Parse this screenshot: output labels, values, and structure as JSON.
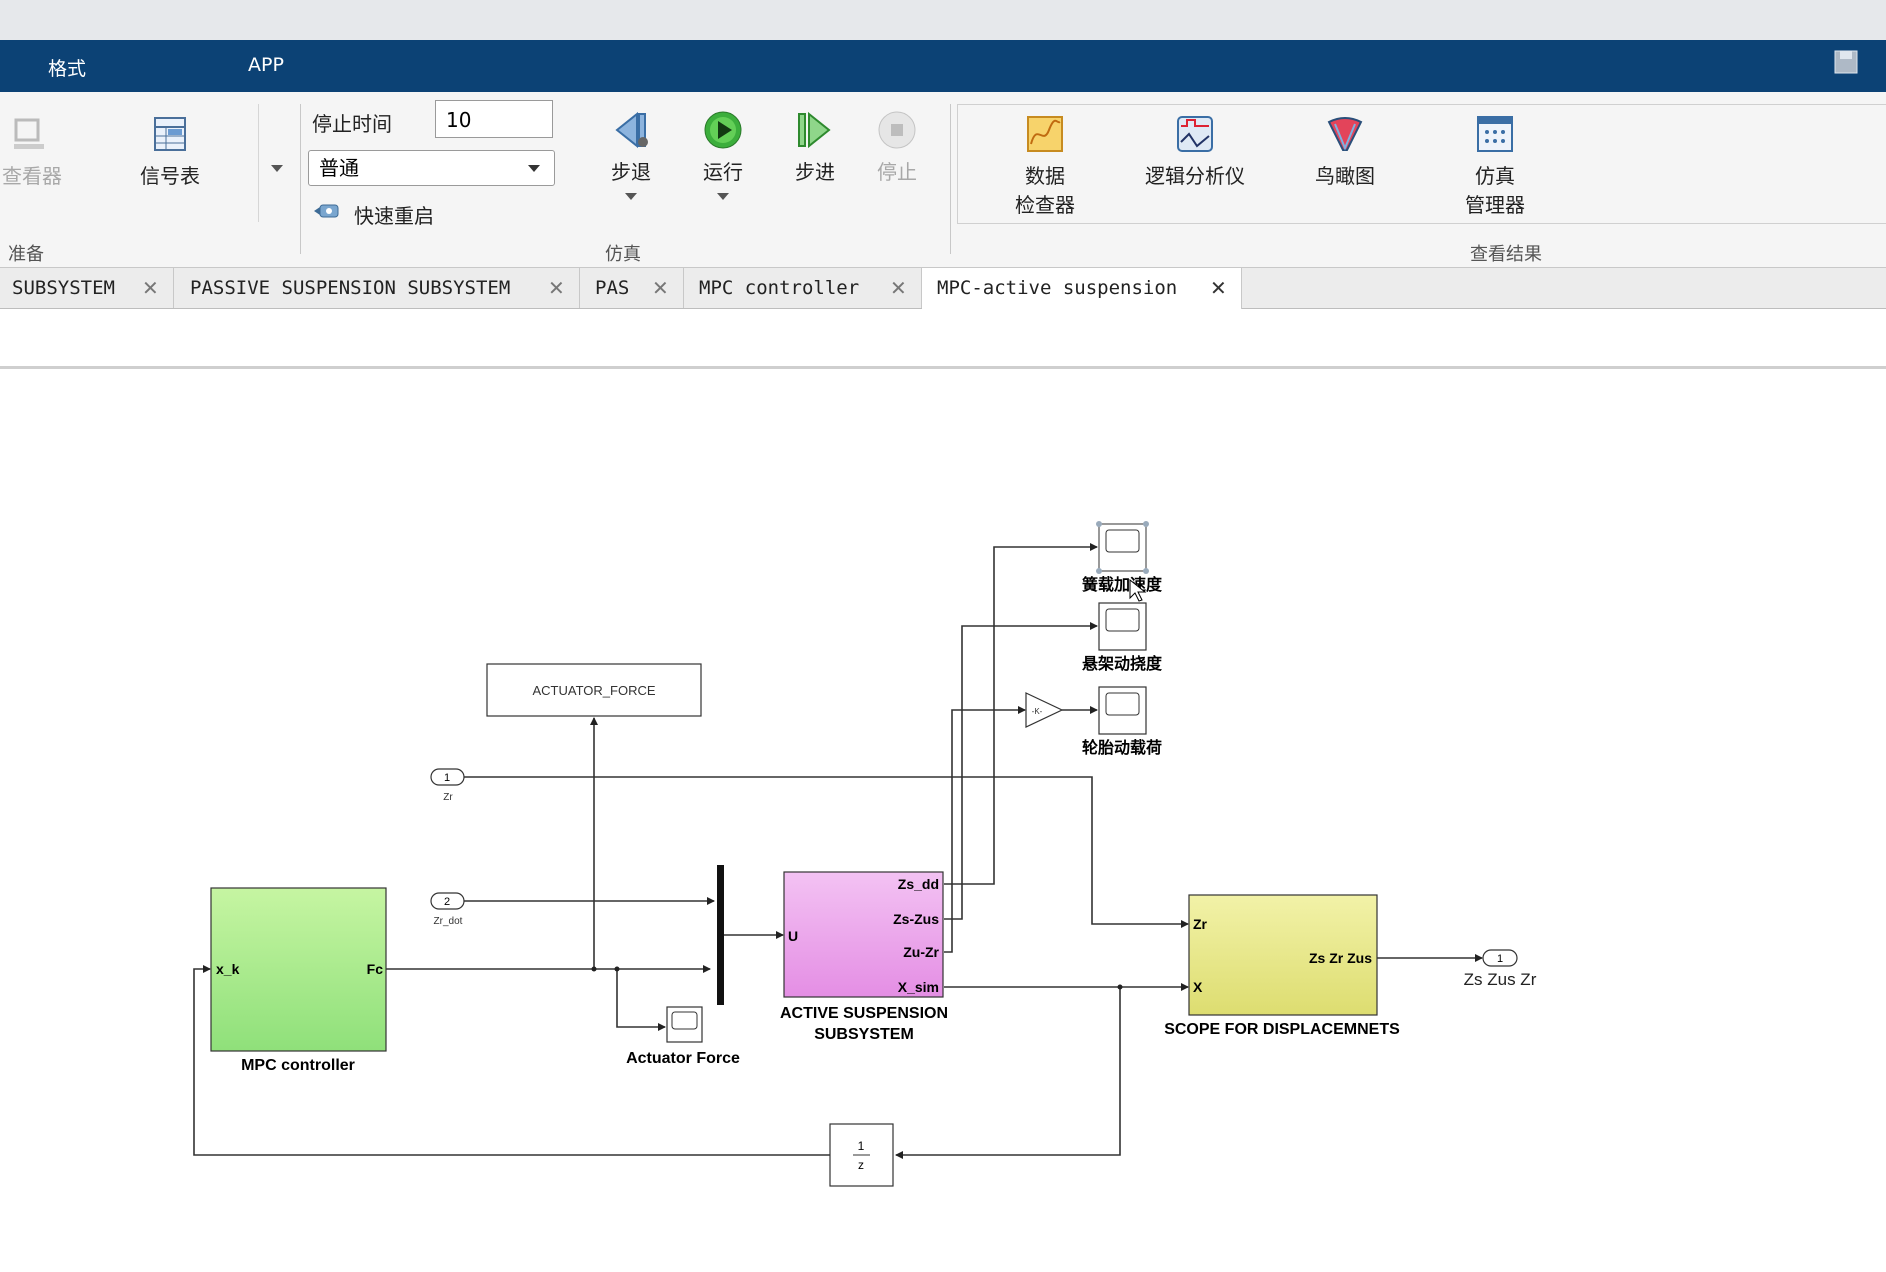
{
  "menu": {
    "format": "格式",
    "app": "APP"
  },
  "ribbon": {
    "prepare": {
      "viewer_label": "查看器",
      "signal_table_label": "信号表",
      "section_label": "准备"
    },
    "simulate": {
      "stop_time_label": "停止时间",
      "stop_time_value": "10",
      "mode_value": "普通",
      "fast_restart_label": "快速重启",
      "step_back_label": "步退",
      "run_label": "运行",
      "step_forward_label": "步进",
      "stop_label": "停止",
      "section_label": "仿真"
    },
    "review": {
      "data_inspector_line1": "数据",
      "data_inspector_line2": "检查器",
      "logic_analyzer_label": "逻辑分析仪",
      "birdseye_label": "鸟瞰图",
      "sim_manager_line1": "仿真",
      "sim_manager_line2": "管理器",
      "section_label": "查看结果"
    }
  },
  "tabs": [
    {
      "label": "SUBSYSTEM"
    },
    {
      "label": "PASSIVE SUSPENSION SUBSYSTEM"
    },
    {
      "label": "PAS"
    },
    {
      "label": "MPC controller"
    },
    {
      "label": "MPC-active suspension",
      "active": true
    }
  ],
  "tab_close_glyph": "✕",
  "diagram": {
    "actuator_force_goto": "ACTUATOR_FORCE",
    "inport1_number": "1",
    "inport1_name": "Zr",
    "inport2_number": "2",
    "inport2_name": "Zr_dot",
    "mpc_block": {
      "name": "MPC controller",
      "in_port": "x_k",
      "out_port": "Fc",
      "color": "#c6f5a2"
    },
    "active_block": {
      "name_line1": "ACTIVE SUSPENSION",
      "name_line2": "SUBSYSTEM",
      "in_port": "U",
      "out_ports": [
        "Zs_dd",
        "Zs-Zus",
        "Zu-Zr",
        "X_sim"
      ],
      "color": "#f3c2f3"
    },
    "scope_block": {
      "name": "SCOPE FOR DISPLACEMNETS",
      "in_ports": [
        "Zr",
        "X"
      ],
      "out_port": "Zs Zr Zus",
      "color": "#f2f2a8"
    },
    "scope1_label": "簧载加速度",
    "scope2_label": "悬架动挠度",
    "scope3_label": "轮胎动载荷",
    "actuator_scope_label": "Actuator Force",
    "outport_number": "1",
    "outport_name": "Zs Zus Zr",
    "gain_label": "-K-",
    "delay_num": "1",
    "delay_den": "z"
  }
}
